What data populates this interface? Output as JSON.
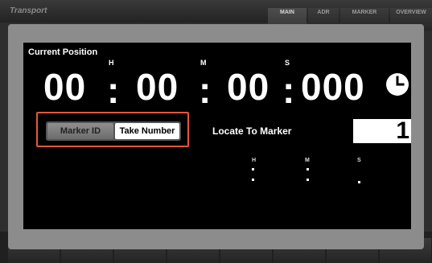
{
  "app": {
    "title": "Transport"
  },
  "tabs": [
    {
      "label": "MAIN",
      "active": true
    },
    {
      "label": "ADR",
      "active": false
    },
    {
      "label": "MARKER",
      "active": false
    },
    {
      "label": "OVERVIEW",
      "active": false
    }
  ],
  "position": {
    "title": "Current Position",
    "hours": "00",
    "minutes": "00",
    "seconds": "00",
    "millis": "000",
    "unit_h": "H",
    "unit_m": "M",
    "unit_s": "S",
    "colon": ":",
    "dot": "."
  },
  "toggle": {
    "left_label": "Marker ID",
    "right_label": "Take Number",
    "selected": "Take Number"
  },
  "locate": {
    "label": "Locate To Marker",
    "value": "1",
    "unit_h": "H",
    "unit_m": "M",
    "unit_s": "S"
  },
  "colors": {
    "highlight": "#e3573a",
    "panel": "#000000",
    "dialog": "#8c8c8c"
  },
  "icons": {
    "clock": "clock-icon"
  }
}
